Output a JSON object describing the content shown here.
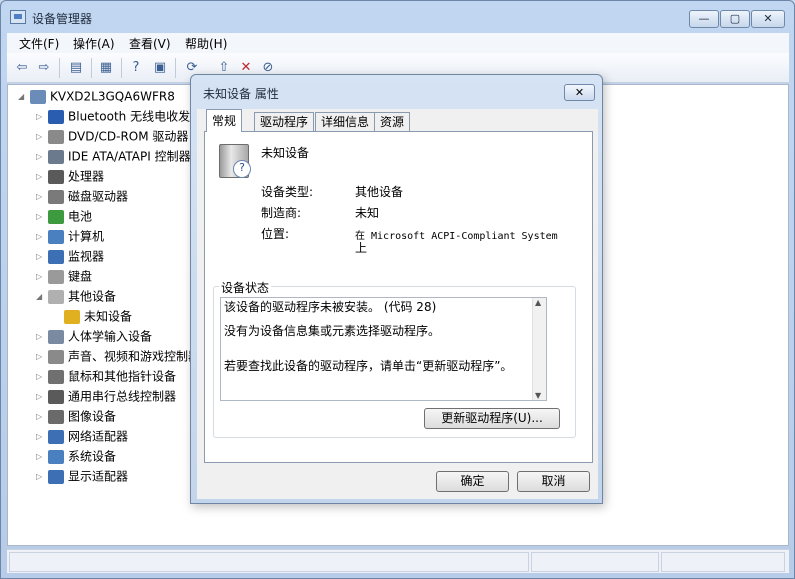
{
  "window": {
    "title": "设备管理器",
    "min": "—",
    "max": "▢",
    "close": "✕"
  },
  "menu": [
    "文件(F)",
    "操作(A)",
    "查看(V)",
    "帮助(H)"
  ],
  "tree": {
    "root": "KVXD2L3GQA6WFR8",
    "items": [
      {
        "label": "Bluetooth 无线电收发器",
        "icon": "bluetooth-icon",
        "color": "#2a5db0"
      },
      {
        "label": "DVD/CD-ROM 驱动器",
        "icon": "dvd-drive-icon",
        "color": "#8a8a8a"
      },
      {
        "label": "IDE ATA/ATAPI 控制器",
        "icon": "ide-controller-icon",
        "color": "#6b7a8c"
      },
      {
        "label": "处理器",
        "icon": "processor-icon",
        "color": "#5a5a5a"
      },
      {
        "label": "磁盘驱动器",
        "icon": "disk-drive-icon",
        "color": "#7a7a7a"
      },
      {
        "label": "电池",
        "icon": "battery-icon",
        "color": "#3e9a3e"
      },
      {
        "label": "计算机",
        "icon": "computer-icon",
        "color": "#4a7fc0"
      },
      {
        "label": "监视器",
        "icon": "monitor-icon",
        "color": "#3c6fb3"
      },
      {
        "label": "键盘",
        "icon": "keyboard-icon",
        "color": "#9a9a9a"
      },
      {
        "label": "其他设备",
        "icon": "other-devices-icon",
        "color": "#b0b0b0"
      },
      {
        "label": "未知设备",
        "icon": "warning-device-icon",
        "color": "#e0b020",
        "child": true
      },
      {
        "label": "人体学输入设备",
        "icon": "hid-icon",
        "color": "#7a8aa0"
      },
      {
        "label": "声音、视频和游戏控制器",
        "icon": "sound-icon",
        "color": "#8a8a8a"
      },
      {
        "label": "鼠标和其他指针设备",
        "icon": "mouse-icon",
        "color": "#707070"
      },
      {
        "label": "通用串行总线控制器",
        "icon": "usb-icon",
        "color": "#5a5a5a"
      },
      {
        "label": "图像设备",
        "icon": "camera-icon",
        "color": "#6a6a6a"
      },
      {
        "label": "网络适配器",
        "icon": "network-adapter-icon",
        "color": "#3c6fb3"
      },
      {
        "label": "系统设备",
        "icon": "system-device-icon",
        "color": "#4a7fc0"
      },
      {
        "label": "显示适配器",
        "icon": "display-adapter-icon",
        "color": "#3c6fb3"
      }
    ]
  },
  "dialog": {
    "title": "未知设备 属性",
    "close": "✕",
    "tabs": [
      "常规",
      "驱动程序",
      "详细信息",
      "资源"
    ],
    "device_name": "未知设备",
    "props": [
      {
        "label": "设备类型:",
        "value": "其他设备"
      },
      {
        "label": "制造商:",
        "value": "未知"
      },
      {
        "label": "位置:",
        "value": "在 Microsoft ACPI-Compliant System",
        "value2": "上"
      }
    ],
    "status_label": "设备状态",
    "status_lines": [
      "该设备的驱动程序未被安装。 (代码 28)",
      "没有为设备信息集或元素选择驱动程序。",
      "若要查找此设备的驱动程序，请单击“更新驱动程序”。"
    ],
    "update_button": "更新驱动程序(U)...",
    "ok_button": "确定",
    "cancel_button": "取消"
  }
}
